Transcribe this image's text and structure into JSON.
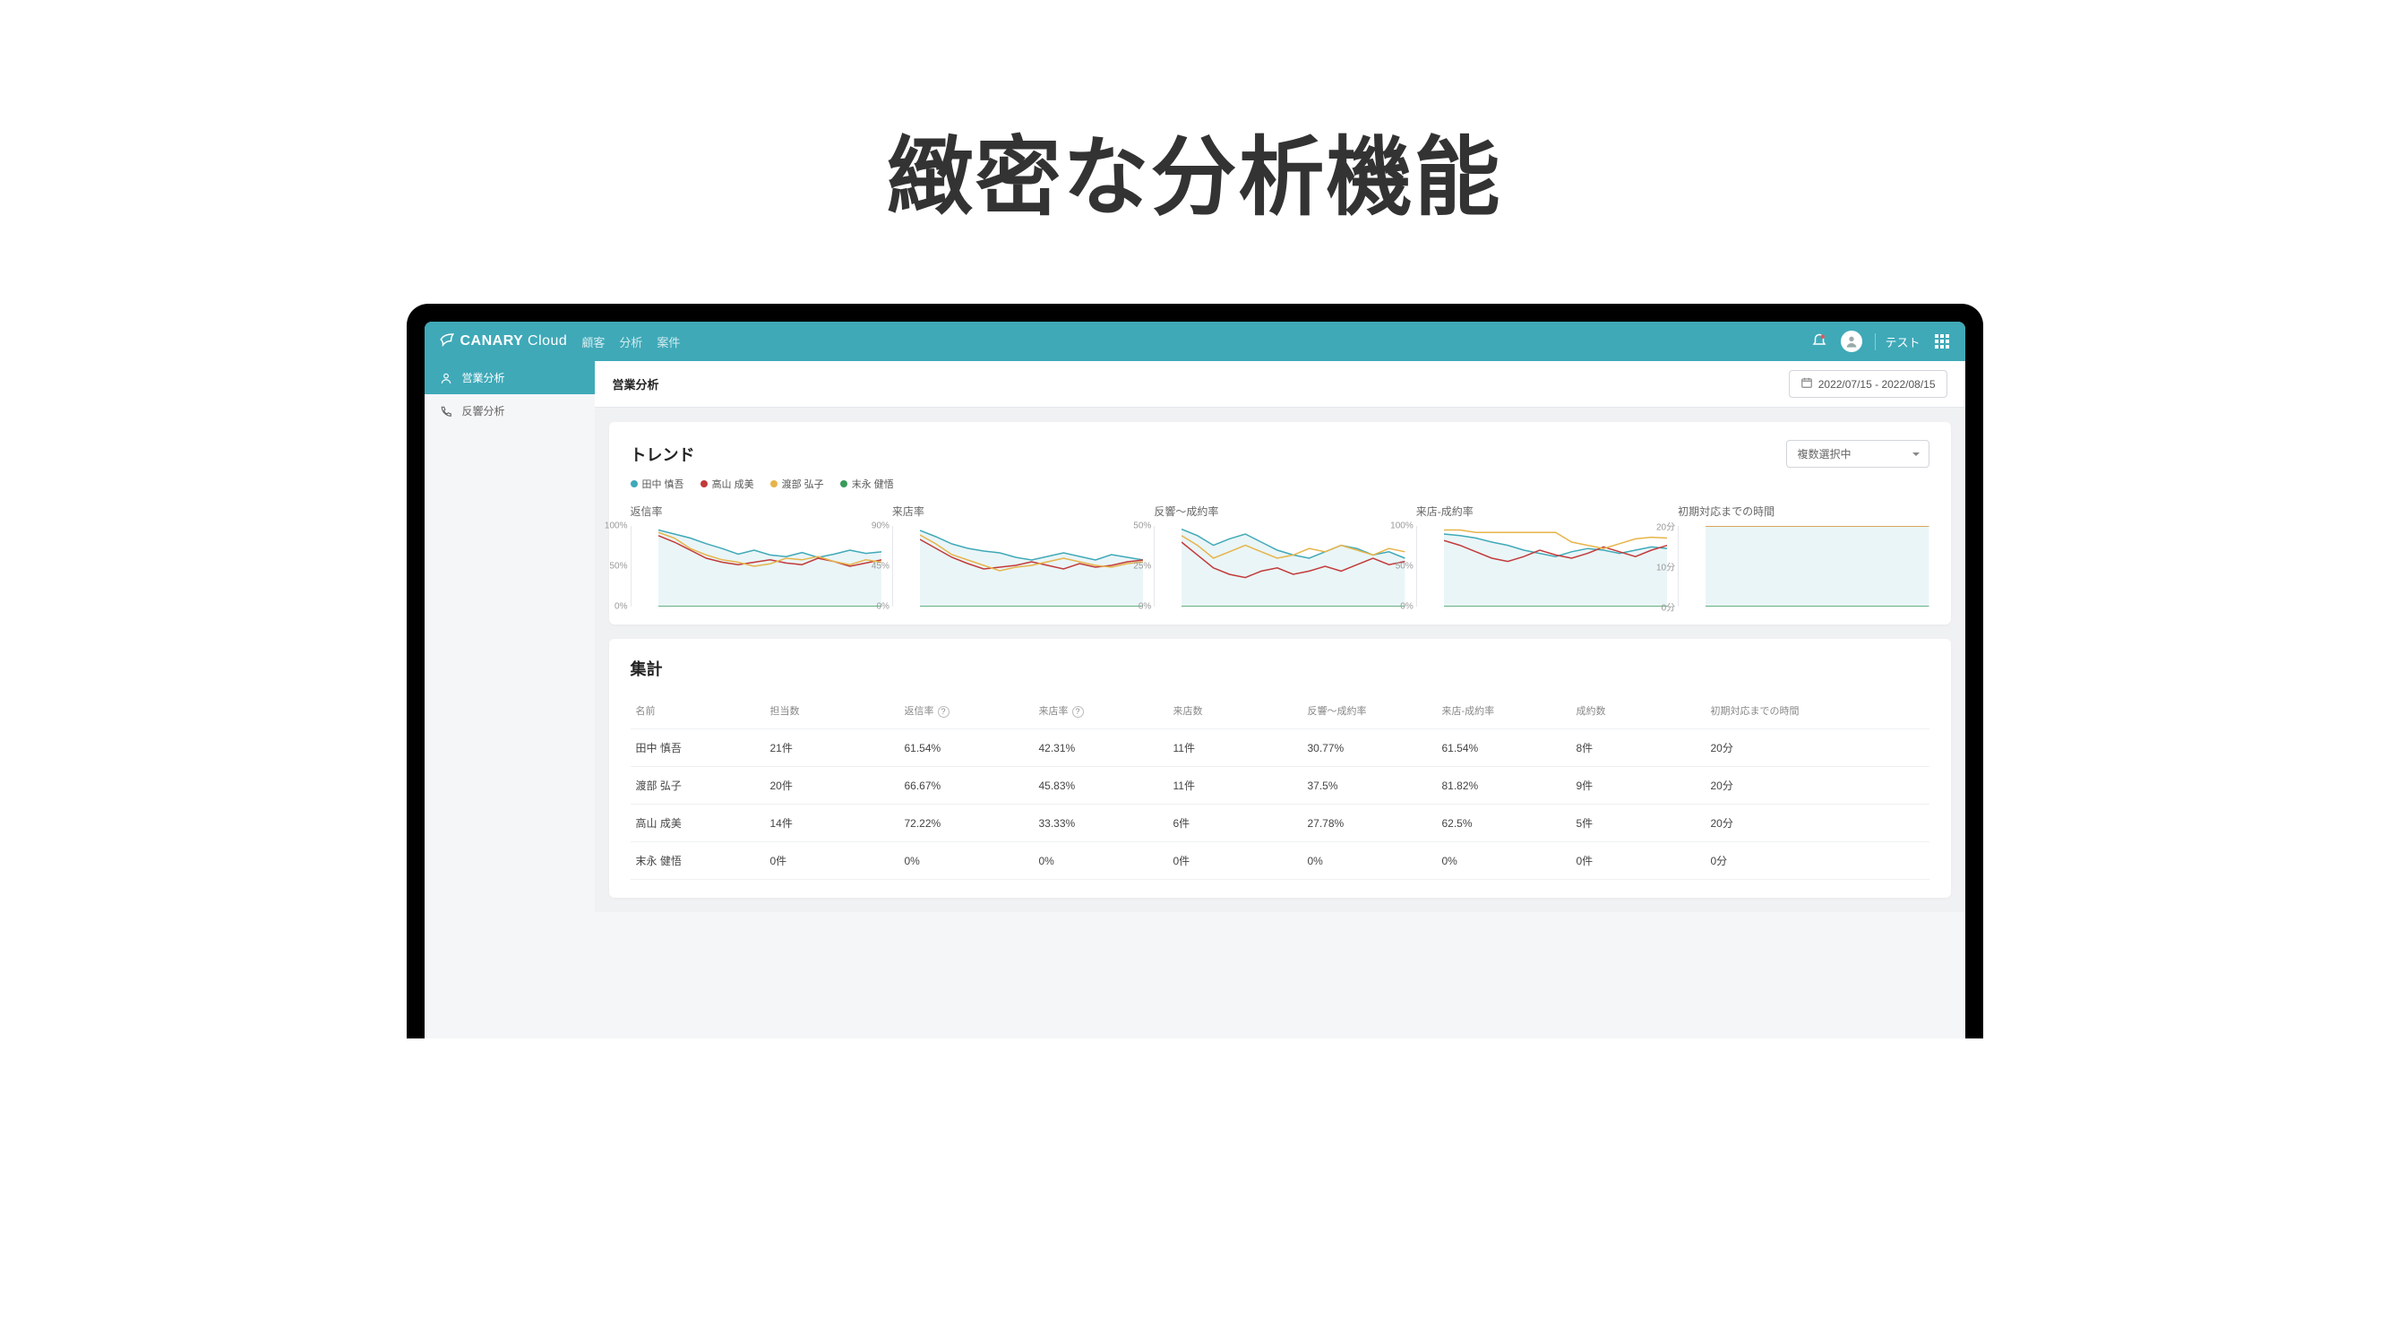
{
  "promo_title": "緻密な分析機能",
  "brand": {
    "name": "CANARY",
    "suffix": "Cloud"
  },
  "topnav": [
    "顧客",
    "分析",
    "案件"
  ],
  "user_label": "テスト",
  "sidebar": {
    "items": [
      {
        "label": "営業分析",
        "active": true
      },
      {
        "label": "反響分析",
        "active": false
      }
    ]
  },
  "page_title": "営業分析",
  "date_range": "2022/07/15 - 2022/08/15",
  "trend": {
    "title": "トレンド",
    "dropdown": "複数選択中",
    "legend": [
      {
        "label": "田中 慎吾",
        "color": "#3fa9b8"
      },
      {
        "label": "高山 成美",
        "color": "#c23a3a"
      },
      {
        "label": "渡部 弘子",
        "color": "#e6b44a"
      },
      {
        "label": "末永 健悟",
        "color": "#3a9a5a"
      }
    ]
  },
  "summary": {
    "title": "集計",
    "columns": [
      "名前",
      "担当数",
      "返信率",
      "来店率",
      "来店数",
      "反響～成約率",
      "来店-成約率",
      "成約数",
      "初期対応までの時間"
    ],
    "help_cols": [
      2,
      3
    ],
    "rows": [
      {
        "name": "田中 慎吾",
        "vals": [
          "21件",
          "61.54%",
          "42.31%",
          "11件",
          "30.77%",
          "61.54%",
          "8件",
          "20分"
        ]
      },
      {
        "name": "渡部 弘子",
        "vals": [
          "20件",
          "66.67%",
          "45.83%",
          "11件",
          "37.5%",
          "81.82%",
          "9件",
          "20分"
        ]
      },
      {
        "name": "高山 成美",
        "vals": [
          "14件",
          "72.22%",
          "33.33%",
          "6件",
          "27.78%",
          "62.5%",
          "5件",
          "20分"
        ]
      },
      {
        "name": "末永 健悟",
        "vals": [
          "0件",
          "0%",
          "0%",
          "0件",
          "0%",
          "0%",
          "0件",
          "0分"
        ]
      }
    ]
  },
  "chart_data": [
    {
      "type": "line",
      "title": "返信率",
      "ylim": [
        0,
        100
      ],
      "yticks": [
        "100%",
        "50%",
        "0%"
      ],
      "x": [
        0,
        1,
        2,
        3,
        4,
        5,
        6,
        7,
        8,
        9,
        10,
        11,
        12,
        13,
        14
      ],
      "series": [
        {
          "name": "田中 慎吾",
          "color": "#3fa9b8",
          "values": [
            95,
            90,
            85,
            78,
            72,
            65,
            70,
            64,
            62,
            67,
            61,
            65,
            70,
            66,
            68
          ]
        },
        {
          "name": "高山 成美",
          "color": "#c23a3a",
          "values": [
            88,
            80,
            70,
            60,
            55,
            52,
            55,
            58,
            54,
            52,
            60,
            56,
            50,
            54,
            58
          ]
        },
        {
          "name": "渡部 弘子",
          "color": "#e6b44a",
          "values": [
            92,
            85,
            72,
            64,
            58,
            55,
            50,
            53,
            60,
            58,
            62,
            56,
            52,
            58,
            55
          ]
        },
        {
          "name": "末永 健悟",
          "color": "#3a9a5a",
          "values": [
            0,
            0,
            0,
            0,
            0,
            0,
            0,
            0,
            0,
            0,
            0,
            0,
            0,
            0,
            0
          ]
        }
      ]
    },
    {
      "type": "line",
      "title": "来店率",
      "ylim": [
        0,
        90
      ],
      "yticks": [
        "90%",
        "45%",
        "0%"
      ],
      "x": [
        0,
        1,
        2,
        3,
        4,
        5,
        6,
        7,
        8,
        9,
        10,
        11,
        12,
        13,
        14
      ],
      "series": [
        {
          "name": "田中 慎吾",
          "color": "#3fa9b8",
          "values": [
            85,
            78,
            70,
            65,
            62,
            60,
            55,
            52,
            56,
            60,
            56,
            52,
            58,
            55,
            52
          ]
        },
        {
          "name": "高山 成美",
          "color": "#c23a3a",
          "values": [
            75,
            65,
            55,
            48,
            42,
            44,
            46,
            50,
            46,
            42,
            48,
            44,
            46,
            50,
            52
          ]
        },
        {
          "name": "渡部 弘子",
          "color": "#e6b44a",
          "values": [
            80,
            70,
            58,
            52,
            46,
            40,
            44,
            46,
            50,
            54,
            50,
            46,
            44,
            48,
            50
          ]
        },
        {
          "name": "末永 健悟",
          "color": "#3a9a5a",
          "values": [
            0,
            0,
            0,
            0,
            0,
            0,
            0,
            0,
            0,
            0,
            0,
            0,
            0,
            0,
            0
          ]
        }
      ]
    },
    {
      "type": "line",
      "title": "反響～成約率",
      "ylim": [
        0,
        50
      ],
      "yticks": [
        "50%",
        "25%",
        "0%"
      ],
      "x": [
        0,
        1,
        2,
        3,
        4,
        5,
        6,
        7,
        8,
        9,
        10,
        11,
        12,
        13,
        14
      ],
      "series": [
        {
          "name": "田中 慎吾",
          "color": "#3fa9b8",
          "values": [
            48,
            44,
            38,
            42,
            45,
            40,
            35,
            32,
            30,
            34,
            38,
            36,
            32,
            34,
            30
          ]
        },
        {
          "name": "高山 成美",
          "color": "#c23a3a",
          "values": [
            40,
            32,
            24,
            20,
            18,
            22,
            24,
            20,
            22,
            25,
            22,
            26,
            30,
            26,
            28
          ]
        },
        {
          "name": "渡部 弘子",
          "color": "#e6b44a",
          "values": [
            44,
            38,
            30,
            34,
            38,
            34,
            30,
            32,
            36,
            34,
            38,
            35,
            32,
            36,
            34
          ]
        },
        {
          "name": "末永 健悟",
          "color": "#3a9a5a",
          "values": [
            0,
            0,
            0,
            0,
            0,
            0,
            0,
            0,
            0,
            0,
            0,
            0,
            0,
            0,
            0
          ]
        }
      ]
    },
    {
      "type": "line",
      "title": "来店-成約率",
      "ylim": [
        0,
        100
      ],
      "yticks": [
        "100%",
        "50%",
        "0%"
      ],
      "x": [
        0,
        1,
        2,
        3,
        4,
        5,
        6,
        7,
        8,
        9,
        10,
        11,
        12,
        13,
        14
      ],
      "series": [
        {
          "name": "田中 慎吾",
          "color": "#3fa9b8",
          "values": [
            90,
            88,
            85,
            80,
            76,
            70,
            66,
            62,
            68,
            72,
            70,
            66,
            70,
            74,
            72
          ]
        },
        {
          "name": "高山 成美",
          "color": "#c23a3a",
          "values": [
            82,
            76,
            68,
            60,
            56,
            62,
            70,
            64,
            60,
            66,
            74,
            68,
            62,
            70,
            76
          ]
        },
        {
          "name": "渡部 弘子",
          "color": "#e6b44a",
          "values": [
            95,
            95,
            92,
            92,
            92,
            92,
            92,
            92,
            80,
            76,
            72,
            78,
            84,
            86,
            85
          ]
        },
        {
          "name": "末永 健悟",
          "color": "#3a9a5a",
          "values": [
            0,
            0,
            0,
            0,
            0,
            0,
            0,
            0,
            0,
            0,
            0,
            0,
            0,
            0,
            0
          ]
        }
      ]
    },
    {
      "type": "line",
      "title": "初期対応までの時間",
      "ylim": [
        0,
        20
      ],
      "yticks": [
        "20分",
        "10分",
        "0分"
      ],
      "x": [
        0,
        1,
        2,
        3,
        4,
        5,
        6,
        7,
        8,
        9,
        10,
        11,
        12,
        13,
        14
      ],
      "series": [
        {
          "name": "田中 慎吾",
          "color": "#3fa9b8",
          "values": [
            20,
            20,
            20,
            20,
            20,
            20,
            20,
            20,
            20,
            20,
            20,
            20,
            20,
            20,
            20
          ]
        },
        {
          "name": "高山 成美",
          "color": "#c23a3a",
          "values": [
            20,
            20,
            20,
            20,
            20,
            20,
            20,
            20,
            20,
            20,
            20,
            20,
            20,
            20,
            20
          ]
        },
        {
          "name": "渡部 弘子",
          "color": "#e6b44a",
          "values": [
            20,
            20,
            20,
            20,
            20,
            20,
            20,
            20,
            20,
            20,
            20,
            20,
            20,
            20,
            20
          ]
        },
        {
          "name": "末永 健悟",
          "color": "#3a9a5a",
          "values": [
            0,
            0,
            0,
            0,
            0,
            0,
            0,
            0,
            0,
            0,
            0,
            0,
            0,
            0,
            0
          ]
        }
      ]
    }
  ]
}
